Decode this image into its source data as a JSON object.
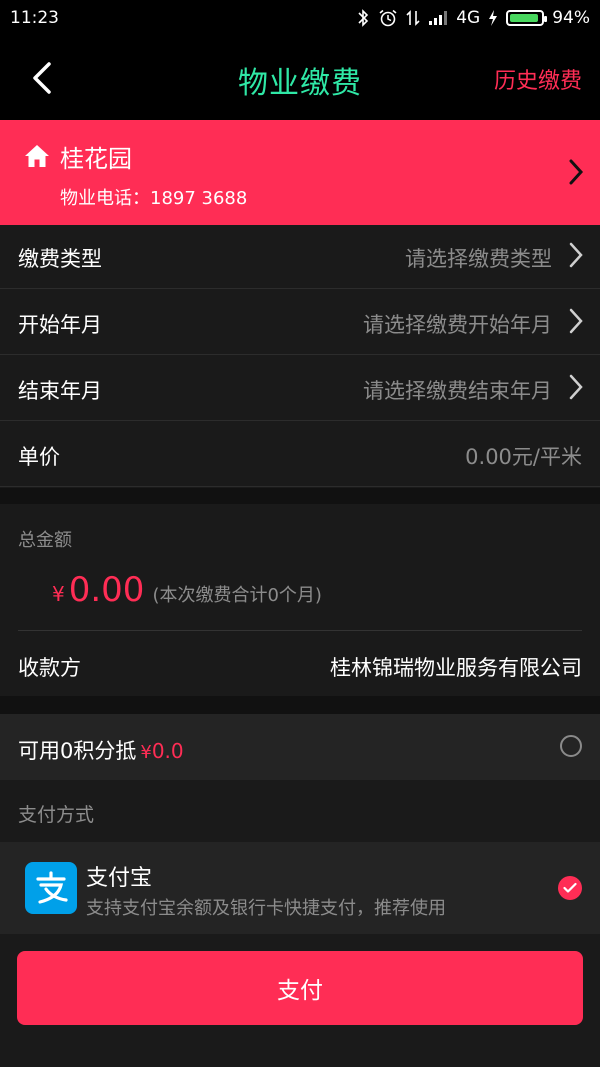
{
  "status_bar": {
    "time": "11:23",
    "network": "4G",
    "battery_percent": "94%",
    "battery_level": 0.94,
    "icons": [
      "bluetooth-icon",
      "alarm-icon",
      "data-arrows-icon",
      "signal-icon",
      "charging-icon",
      "battery-icon"
    ]
  },
  "header": {
    "title": "物业缴费",
    "history_link": "历史缴费",
    "back_icon": "back-arrow-icon",
    "title_color": "#2fe8a6",
    "accent_color": "#ff2d55"
  },
  "community": {
    "name": "桂花园",
    "phone_label": "物业电话：",
    "phone_value": "1897 3688",
    "icon": "home-icon"
  },
  "form": {
    "rows": [
      {
        "label": "缴费类型",
        "placeholder": "请选择缴费类型"
      },
      {
        "label": "开始年月",
        "placeholder": "请选择缴费开始年月"
      },
      {
        "label": "结束年月",
        "placeholder": "请选择缴费结束年月"
      },
      {
        "label": "单价",
        "value": "0.00元/平米"
      }
    ]
  },
  "total": {
    "caption": "总金额",
    "currency": "¥",
    "amount": "0.00",
    "note": "(本次缴费合计0个月)",
    "payee_label": "收款方",
    "payee_value": "桂林锦瑞物业服务有限公司"
  },
  "points": {
    "label": "可用0积分抵",
    "currency": "¥",
    "amount": "0.0",
    "selected": false
  },
  "payment": {
    "caption": "支付方式",
    "method_name": "支付宝",
    "method_desc": "支持支付宝余额及银行卡快捷支付，推荐使用",
    "logo_glyph": "支",
    "selected": true
  },
  "pay_button": {
    "label": "支付"
  }
}
